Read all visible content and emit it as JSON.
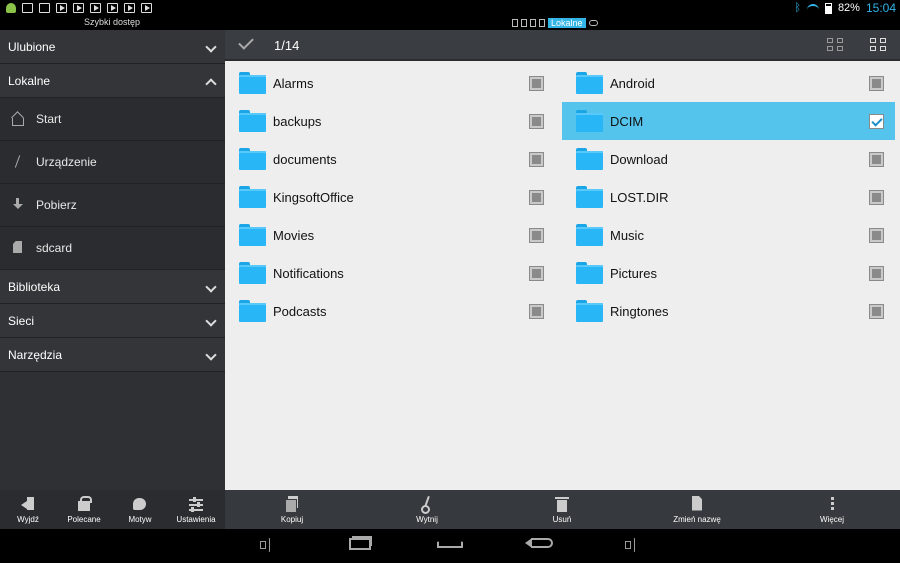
{
  "statusbar": {
    "battery": "82%",
    "time": "15:04",
    "quick_access": "Szybki dostęp",
    "location_active": "Lokalne"
  },
  "sidebar": {
    "sections": [
      {
        "label": "Ulubione",
        "expanded": false
      },
      {
        "label": "Lokalne",
        "expanded": true
      },
      {
        "label": "Biblioteka",
        "expanded": false
      },
      {
        "label": "Sieci",
        "expanded": false
      },
      {
        "label": "Narzędzia",
        "expanded": false
      }
    ],
    "local_items": [
      {
        "label": "Start",
        "icon": "home-icon"
      },
      {
        "label": "Urządzenie",
        "icon": "device-icon"
      },
      {
        "label": "Pobierz",
        "icon": "download-icon"
      },
      {
        "label": "sdcard",
        "icon": "sdcard-icon"
      }
    ],
    "toolbar": [
      {
        "label": "Wyjdź",
        "icon": "exit-icon"
      },
      {
        "label": "Polecane",
        "icon": "gift-icon"
      },
      {
        "label": "Motyw",
        "icon": "palette-icon"
      },
      {
        "label": "Ustawienia",
        "icon": "sliders-icon"
      }
    ]
  },
  "header": {
    "selection_count": "1/14"
  },
  "files": {
    "left": [
      {
        "name": "Alarms",
        "checked": false
      },
      {
        "name": "backups",
        "checked": false
      },
      {
        "name": "documents",
        "checked": false
      },
      {
        "name": "KingsoftOffice",
        "checked": false
      },
      {
        "name": "Movies",
        "checked": false
      },
      {
        "name": "Notifications",
        "checked": false
      },
      {
        "name": "Podcasts",
        "checked": false
      }
    ],
    "right": [
      {
        "name": "Android",
        "checked": false
      },
      {
        "name": "DCIM",
        "checked": true
      },
      {
        "name": "Download",
        "checked": false
      },
      {
        "name": "LOST.DIR",
        "checked": false
      },
      {
        "name": "Music",
        "checked": false
      },
      {
        "name": "Pictures",
        "checked": false
      },
      {
        "name": "Ringtones",
        "checked": false
      }
    ]
  },
  "actions": {
    "copy": "Kopiuj",
    "cut": "Wytnij",
    "delete": "Usuń",
    "rename": "Zmień nazwę",
    "more": "Więcej"
  },
  "colors": {
    "accent": "#33b5e5",
    "selected_row": "#55c4ec",
    "folder": "#29b6f6"
  }
}
